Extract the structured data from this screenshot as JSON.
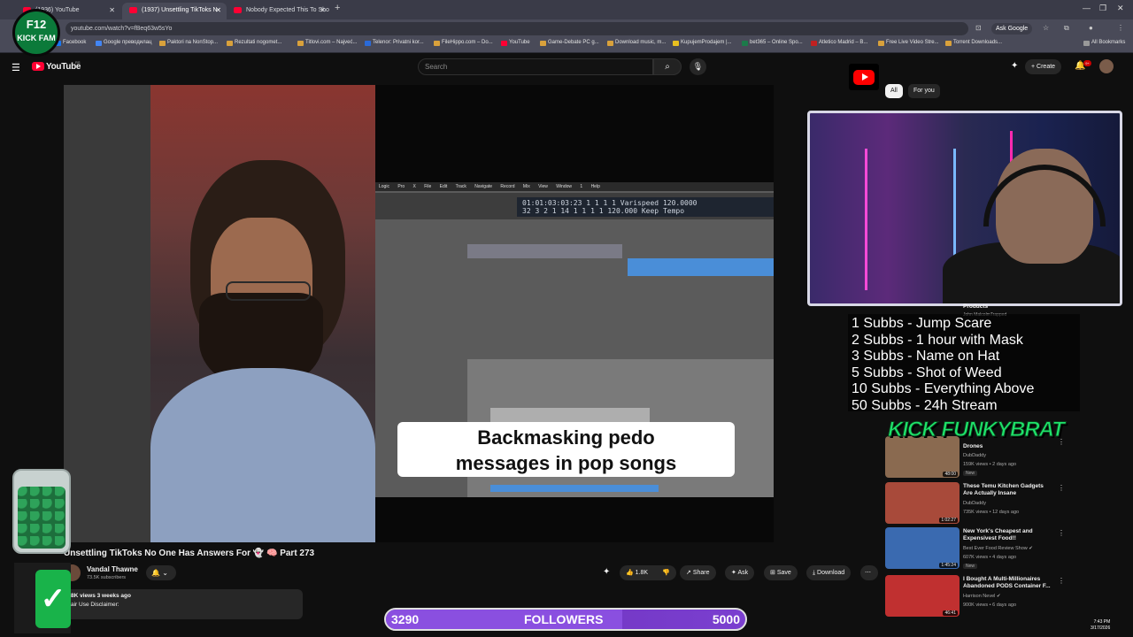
{
  "browser": {
    "tabs": [
      {
        "title": "(1936) YouTube",
        "active": false
      },
      {
        "title": "(1937) Unsettling TikToks N",
        "active": true
      },
      {
        "title": "Nobody Expected This To Sho",
        "active": false
      }
    ],
    "url": "youtube.com/watch?v=fBeq63w5sYo",
    "ask_google": "Ask Google",
    "bookmarks": [
      "Facebook",
      "Google преводилац",
      "Paktori na NonStop...",
      "Rezultati nogomet...",
      "Titlovi.com – Najveć...",
      "Telenor: Privatni kor...",
      "FileHippo.com – Do...",
      "YouTube",
      "Game-Debate PC g...",
      "Download music, m...",
      "KupujemProdajem |...",
      "bet365 – Online Spo...",
      "Atletico Madrid – B...",
      "Free Live Video Stre...",
      "Torrent Downloads..."
    ],
    "all_bookmarks": "All Bookmarks"
  },
  "youtube": {
    "logo_text": "YouTube",
    "country_code": "RS",
    "search_placeholder": "Search",
    "create_label": "Create",
    "notif_count": "9+"
  },
  "video": {
    "caption_line1": "Backmasking pedo",
    "caption_line2": "messages in pop songs",
    "daw_menu": "Logic Pro X   File   Edit   Track   Navigate   Record   Mix   View   Window   1   Help",
    "daw_lcd_line1": "01:01:03:03:23    1   1   1   1   Varispeed   120.0000",
    "daw_lcd_line2": "32   3   2   1   14       1   1   1   1   120.000   Keep Tempo",
    "title": "Unsettling TikToks No One Has Answers For 👻 🧠 Part 273",
    "channel": "Vandal Thawne",
    "subscribers": "73.5K subscribers",
    "likes": "1.8K",
    "share": "Share",
    "ask": "Ask",
    "save": "Save",
    "download": "Download",
    "desc_meta": "8K views  3 weeks ago",
    "desc_text": "air Use Disclaimer:"
  },
  "chips": [
    "All",
    "For you"
  ],
  "stream": {
    "badge_line1": "F12",
    "badge_line2": "KICK FAM",
    "goals": [
      "1 Subbs - Jump Scare",
      "2 Subbs - 1 hour with Mask",
      "3 Subbs - Name on Hat",
      "5 Subbs - Shot of Weed",
      "10 Subbs - Everything Above",
      "50 Subbs - 24h Stream"
    ],
    "kick_logo": "KICK FUNKYBRAT",
    "followers_current": "3290",
    "followers_label": "FOLLOWERS",
    "followers_goal": "5000",
    "followers_progress": 0.658
  },
  "recommendations": [
    {
      "title": "Drones",
      "channel": "DubDaddy",
      "meta": "159K views • 2 days ago",
      "badge": "New",
      "duration": "48:00",
      "color": "#8a6a50"
    },
    {
      "title": "These Temu Kitchen Gadgets Are Actually Insane",
      "channel": "DubDaddy",
      "meta": "735K views • 12 days ago",
      "badge": "",
      "duration": "1:02:27",
      "color": "#a84a3a"
    },
    {
      "title": "New York's Cheapest and Expensivest Food!!",
      "channel": "Best Ever Food Review Show ✔",
      "meta": "607K views • 4 days ago",
      "badge": "New",
      "duration": "1:45:24",
      "color": "#3a6ab0"
    },
    {
      "title": "I Bought A Multi-Millionaires Abandoned PODS Container F...",
      "channel": "Harrison Nevel ✔",
      "meta": "900K views • 6 days ago",
      "badge": "",
      "duration": "46:41",
      "color": "#c03030"
    }
  ],
  "rec_hidden": {
    "channel": "John MalcolmTrapped",
    "title": "Products"
  },
  "clock": {
    "time": "7:43 PM",
    "date": "3/17/2026"
  },
  "colors": {
    "accent": "#ff0033",
    "kick_green": "#1ee36a",
    "follower_bar": "#7b3fd0"
  }
}
